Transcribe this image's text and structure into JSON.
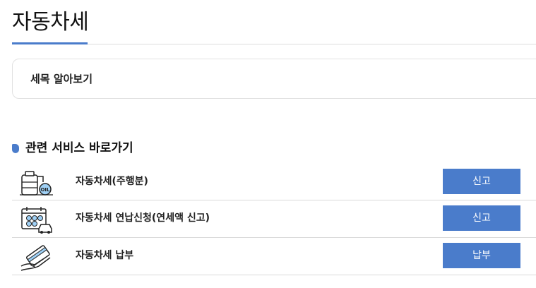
{
  "page": {
    "title": "자동차세"
  },
  "info_box": {
    "label": "세목 알아보기"
  },
  "section": {
    "heading": "관련 서비스 바로가기"
  },
  "services": [
    {
      "label": "자동차세(주행분)",
      "button": "신고",
      "icon": "fuel-tank-oil-icon"
    },
    {
      "label": "자동차세 연납신청(연세액 신고)",
      "button": "신고",
      "icon": "calendar-car-icon"
    },
    {
      "label": "자동차세 납부",
      "button": "납부",
      "icon": "payment-card-hand-icon"
    }
  ],
  "colors": {
    "accent": "#4a7ccb",
    "divider": "#d9d9d9"
  }
}
